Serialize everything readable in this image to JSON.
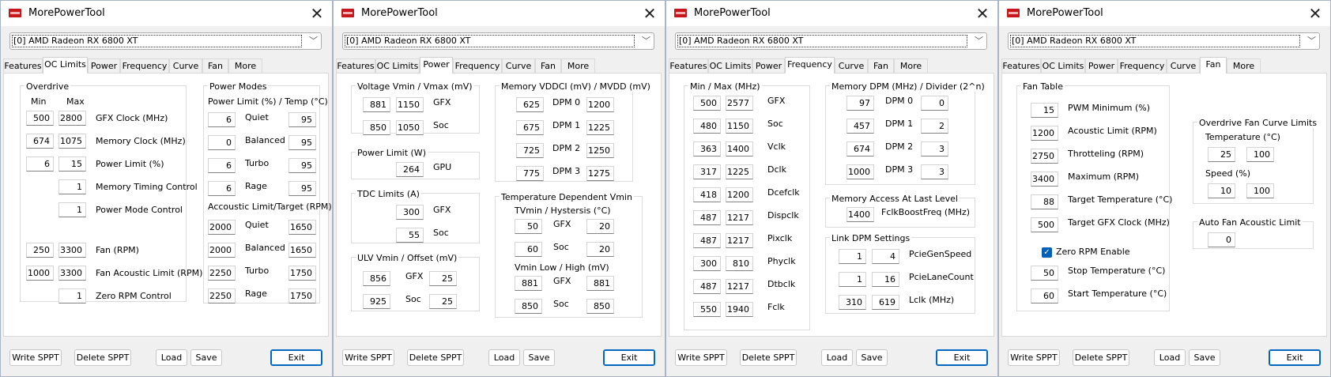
{
  "app_title": "MorePowerTool",
  "device": "[0] AMD Radeon RX 6800 XT",
  "tabs": [
    "Features",
    "OC Limits",
    "Power",
    "Frequency",
    "Curve",
    "Fan",
    "More"
  ],
  "buttons": {
    "write": "Write SPPT",
    "delete": "Delete SPPT",
    "load": "Load",
    "save": "Save",
    "exit": "Exit"
  },
  "oc": {
    "overdrive": "Overdrive",
    "min": "Min",
    "max": "Max",
    "rows": [
      {
        "min": "500",
        "max": "2800",
        "label": "GFX Clock (MHz)"
      },
      {
        "min": "674",
        "max": "1075",
        "label": "Memory Clock (MHz)"
      },
      {
        "min": "6",
        "max": "15",
        "label": "Power Limit (%)"
      },
      {
        "max": "1",
        "label": "Memory Timing Control"
      },
      {
        "max": "1",
        "label": "Power Mode Control"
      },
      {
        "min": "250",
        "max": "3300",
        "label": "Fan (RPM)"
      },
      {
        "min": "1000",
        "max": "3300",
        "label": "Fan Acoustic Limit (RPM)"
      },
      {
        "max": "1",
        "label": "Zero RPM Control"
      }
    ],
    "power_modes": "Power Modes",
    "pl_temp": "Power Limit (%) / Temp (°C)",
    "modes": [
      {
        "a": "6",
        "label": "Quiet",
        "b": "95"
      },
      {
        "a": "0",
        "label": "Balanced",
        "b": "95"
      },
      {
        "a": "6",
        "label": "Turbo",
        "b": "95"
      },
      {
        "a": "6",
        "label": "Rage",
        "b": "95"
      }
    ],
    "acoustic": "Accoustic Limit/Target (RPM)",
    "ac_modes": [
      {
        "a": "2000",
        "label": "Quiet",
        "b": "1650"
      },
      {
        "a": "2000",
        "label": "Balanced",
        "b": "1650"
      },
      {
        "a": "2250",
        "label": "Turbo",
        "b": "1750"
      },
      {
        "a": "2250",
        "label": "Rage",
        "b": "1750"
      }
    ]
  },
  "power": {
    "vmin_title": "Voltage Vmin / Vmax (mV)",
    "vmin": [
      {
        "a": "881",
        "b": "1150",
        "label": "GFX"
      },
      {
        "a": "850",
        "b": "1050",
        "label": "Soc"
      }
    ],
    "pl_title": "Power Limit (W)",
    "pl": {
      "v": "264",
      "label": "GPU"
    },
    "tdc_title": "TDC Limits (A)",
    "tdc": [
      {
        "v": "300",
        "label": "GFX"
      },
      {
        "v": "55",
        "label": "Soc"
      }
    ],
    "ulv_title": "ULV Vmin / Offset (mV)",
    "ulv": [
      {
        "a": "856",
        "label": "GFX",
        "b": "25"
      },
      {
        "a": "925",
        "label": "Soc",
        "b": "25"
      }
    ],
    "vddci_title": "Memory VDDCI (mV) / MVDD (mV)",
    "vddci": [
      {
        "a": "625",
        "label": "DPM 0",
        "b": "1200"
      },
      {
        "a": "675",
        "label": "DPM 1",
        "b": "1225"
      },
      {
        "a": "725",
        "label": "DPM 2",
        "b": "1250"
      },
      {
        "a": "775",
        "label": "DPM 3",
        "b": "1275"
      }
    ],
    "tdv_title": "Temperature Dependent Vmin",
    "tv_hyst": "TVmin / Hystersis (°C)",
    "tv": [
      {
        "a": "50",
        "label": "GFX",
        "b": "20"
      },
      {
        "a": "60",
        "label": "Soc",
        "b": "20"
      }
    ],
    "vlh": "Vmin Low / High (mV)",
    "vl": [
      {
        "a": "881",
        "label": "GFX",
        "b": "881"
      },
      {
        "a": "850",
        "label": "Soc",
        "b": "850"
      }
    ]
  },
  "freq": {
    "minmax": "Min / Max (MHz)",
    "rows": [
      {
        "a": "500",
        "b": "2577",
        "label": "GFX"
      },
      {
        "a": "480",
        "b": "1150",
        "label": "Soc"
      },
      {
        "a": "363",
        "b": "1400",
        "label": "Vclk"
      },
      {
        "a": "317",
        "b": "1225",
        "label": "Dclk"
      },
      {
        "a": "418",
        "b": "1200",
        "label": "Dcefclk"
      },
      {
        "a": "487",
        "b": "1217",
        "label": "Dispclk"
      },
      {
        "a": "487",
        "b": "1217",
        "label": "Pixclk"
      },
      {
        "a": "300",
        "b": "810",
        "label": "Phyclk"
      },
      {
        "a": "487",
        "b": "1217",
        "label": "Dtbclk"
      },
      {
        "a": "550",
        "b": "1940",
        "label": "Fclk"
      }
    ],
    "mdpm_title": "Memory DPM (MHz) / Divider (2^n)",
    "mdpm": [
      {
        "a": "97",
        "label": "DPM 0",
        "b": "0"
      },
      {
        "a": "457",
        "label": "DPM 1",
        "b": "2"
      },
      {
        "a": "674",
        "label": "DPM 2",
        "b": "3"
      },
      {
        "a": "1000",
        "label": "DPM 3",
        "b": "3"
      }
    ],
    "mal_title": "Memory Access At Last Level",
    "mal": {
      "v": "1400",
      "label": "FclkBoostFreq (MHz)"
    },
    "ldpm_title": "Link DPM Settings",
    "ldpm": [
      {
        "a": "1",
        "b": "4",
        "label": "PcieGenSpeed"
      },
      {
        "a": "1",
        "b": "16",
        "label": "PcieLaneCount"
      },
      {
        "a": "310",
        "b": "619",
        "label": "Lclk (MHz)"
      }
    ]
  },
  "fan": {
    "table_title": "Fan Table",
    "rows": [
      {
        "v": "15",
        "label": "PWM Minimum (%)"
      },
      {
        "v": "1200",
        "label": "Acoustic Limit (RPM)"
      },
      {
        "v": "2750",
        "label": "Throtteling (RPM)"
      },
      {
        "v": "3400",
        "label": "Maximum (RPM)"
      },
      {
        "v": "88",
        "label": "Target Temperature (°C)"
      },
      {
        "v": "500",
        "label": "Target GFX Clock (MHz)"
      }
    ],
    "zero_rpm": "Zero RPM Enable",
    "rows2": [
      {
        "v": "50",
        "label": "Stop Temperature (°C)"
      },
      {
        "v": "60",
        "label": "Start Temperature (°C)"
      }
    ],
    "od_title": "Overdrive Fan Curve Limits",
    "temp": "Temperature (°C)",
    "temp_a": "25",
    "temp_b": "100",
    "speed": "Speed (%)",
    "speed_a": "10",
    "speed_b": "100",
    "afa_title": "Auto Fan Acoustic Limit",
    "afa": "0"
  }
}
